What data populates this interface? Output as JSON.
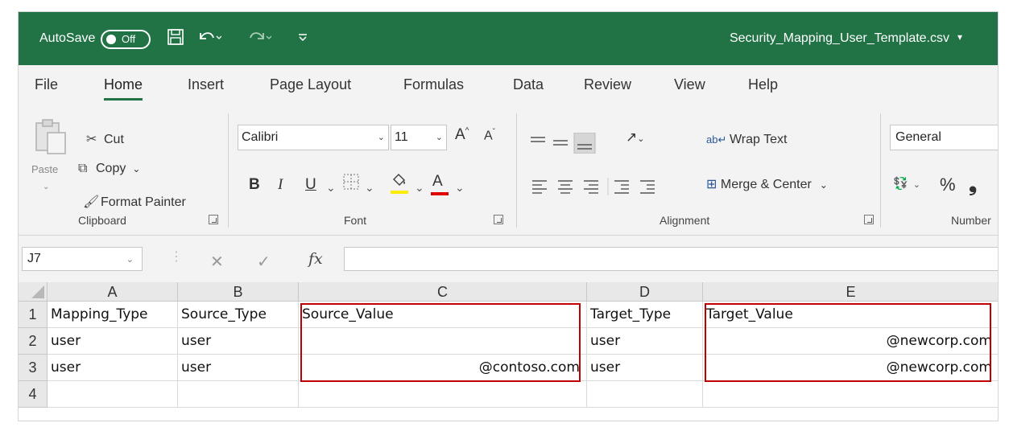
{
  "titlebar": {
    "autosave_label": "AutoSave",
    "autosave_state": "Off",
    "filename": "Security_Mapping_User_Template.csv",
    "filename_caret": "▾",
    "icons": [
      "save-icon",
      "undo-icon",
      "redo-icon",
      "customize-quick-access-icon"
    ]
  },
  "tabs": [
    "File",
    "Home",
    "Insert",
    "Page Layout",
    "Formulas",
    "Data",
    "Review",
    "View",
    "Help"
  ],
  "active_tab": "Home",
  "ribbon": {
    "clipboard": {
      "paste": "Paste",
      "cut": "Cut",
      "copy": "Copy",
      "format_painter": "Format Painter",
      "group_label": "Clipboard"
    },
    "font": {
      "family": "Calibri",
      "size": "11",
      "grow": "A",
      "shrink": "A",
      "bold": "B",
      "italic": "I",
      "underline": "U",
      "font_color": "A",
      "group_label": "Font"
    },
    "alignment": {
      "wrap_text": "Wrap Text",
      "merge_center": "Merge & Center",
      "group_label": "Alignment"
    },
    "number": {
      "format": "General",
      "percent": "%",
      "comma": "❟",
      "group_label": "Number"
    }
  },
  "formula_bar": {
    "name_box": "J7",
    "fx": "fx",
    "formula": ""
  },
  "sheet": {
    "columns": [
      "A",
      "B",
      "C",
      "D",
      "E"
    ],
    "rows": [
      {
        "num": "1",
        "cells": [
          "Mapping_Type",
          "Source_Type",
          "Source_Value",
          "Target_Type",
          "Target_Value"
        ]
      },
      {
        "num": "2",
        "cells": [
          "user",
          "user",
          "",
          "user",
          "@newcorp.com"
        ]
      },
      {
        "num": "3",
        "cells": [
          "user",
          "user",
          "@contoso.com",
          "user",
          "@newcorp.com"
        ]
      },
      {
        "num": "4",
        "cells": [
          "",
          "",
          "",
          "",
          ""
        ]
      }
    ]
  },
  "colors": {
    "excel_green": "#217346",
    "highlight_red": "#c00000",
    "highlight_yellow": "#ffeb00",
    "font_red": "#e00000"
  }
}
